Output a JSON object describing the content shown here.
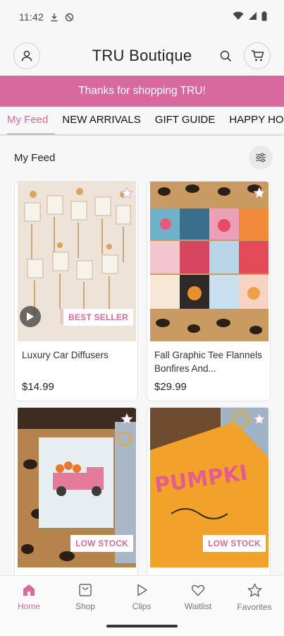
{
  "status_bar": {
    "time": "11:42"
  },
  "header": {
    "title": "TRU Boutique"
  },
  "banner": {
    "text": "Thanks for shopping TRU!"
  },
  "tabs": [
    {
      "label": "My Feed"
    },
    {
      "label": "NEW ARRIVALS"
    },
    {
      "label": "GIFT GUIDE"
    },
    {
      "label": "HAPPY HOUR"
    }
  ],
  "feed": {
    "title": "My Feed"
  },
  "products": [
    {
      "name": "Luxury Car Diffusers",
      "price": "$14.99",
      "badge": "BEST SELLER"
    },
    {
      "name": "Fall Graphic Tee Flannels Bonfires And...",
      "price": "$29.99",
      "badge": ""
    },
    {
      "name": "",
      "price": "",
      "badge": "LOW STOCK"
    },
    {
      "name": "",
      "price": "",
      "badge": "LOW STOCK"
    }
  ],
  "bottom_nav": [
    {
      "label": "Home",
      "icon": "home-icon"
    },
    {
      "label": "Shop",
      "icon": "shop-icon"
    },
    {
      "label": "Clips",
      "icon": "play-icon"
    },
    {
      "label": "Waitlist",
      "icon": "heart-icon"
    },
    {
      "label": "Favorites",
      "icon": "star-icon"
    }
  ],
  "colors": {
    "accent": "#d56a9b",
    "banner": "#d7699e"
  }
}
